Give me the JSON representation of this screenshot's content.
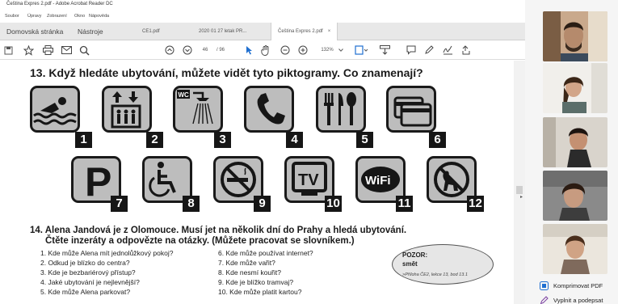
{
  "window": {
    "title": "Čeština Expres 2.pdf - Adobe Acrobat Reader DC",
    "menu": [
      "Soubor",
      "Úpravy",
      "Zobrazení",
      "Okno",
      "Nápověda"
    ]
  },
  "tabs": {
    "home": "Domovská stránka",
    "tools": "Nástroje",
    "docs": [
      "CE1.pdf",
      "2020 01 27 letak PR...",
      "Čeština Expres 2.pdf"
    ],
    "close": "×"
  },
  "toolbar": {
    "page_value": "46",
    "page_total": "/ 96",
    "zoom": "132%"
  },
  "document": {
    "exercise13_title": "13. Když hledáte ubytování, můžete vidět tyto piktogramy. Co znamenají?",
    "pictograms": [
      {
        "num": "1",
        "icon": "swimming-icon"
      },
      {
        "num": "2",
        "icon": "elevator-icon",
        "text": ""
      },
      {
        "num": "3",
        "icon": "shower-icon",
        "text": "WC"
      },
      {
        "num": "4",
        "icon": "phone-icon"
      },
      {
        "num": "5",
        "icon": "restaurant-icon"
      },
      {
        "num": "6",
        "icon": "credit-card-icon"
      },
      {
        "num": "7",
        "icon": "parking-icon",
        "text": "P"
      },
      {
        "num": "8",
        "icon": "wheelchair-icon"
      },
      {
        "num": "9",
        "icon": "no-smoking-icon"
      },
      {
        "num": "10",
        "icon": "tv-icon",
        "text": "TV"
      },
      {
        "num": "11",
        "icon": "wifi-icon",
        "text": "WiFi"
      },
      {
        "num": "12",
        "icon": "no-dogs-icon"
      }
    ],
    "exercise14_title_line1": "14. Alena Jandová je z Olomouce. Musí jet na několik dní do Prahy a hledá ubytování.",
    "exercise14_title_line2": "Čtěte inzeráty a odpovězte na otázky. (Můžete pracovat se slovníkem.)",
    "questions_left": [
      "1.  Kde může Alena mít jednolůžkový pokoj?",
      "2.  Odkud je blízko do centra?",
      "3.  Kde je bezbariérový přístup?",
      "4.  Jaké ubytování je nejlevnější?",
      "5.  Kde může Alena parkovat?"
    ],
    "questions_right": [
      "6.  Kde může používat internet?",
      "7.  Kde může vařit?",
      "8.  Kde nesmí kouřit?",
      "9.  Kde je blížko tramvaj?",
      "10. Kde může platit kartou?"
    ],
    "pozor": {
      "label": "POZOR:",
      "word": "smět",
      "ref": ">Příloha ČE2, lekce 13, bod 13.1"
    }
  },
  "sidebar": {
    "compress": "Komprimovat PDF",
    "sign": "Vyplnit a podepsat"
  },
  "colors": {
    "accent": "#1f6fd0",
    "pictogram_bg": "#bdbdbd",
    "pictogram_dark": "#161616"
  }
}
